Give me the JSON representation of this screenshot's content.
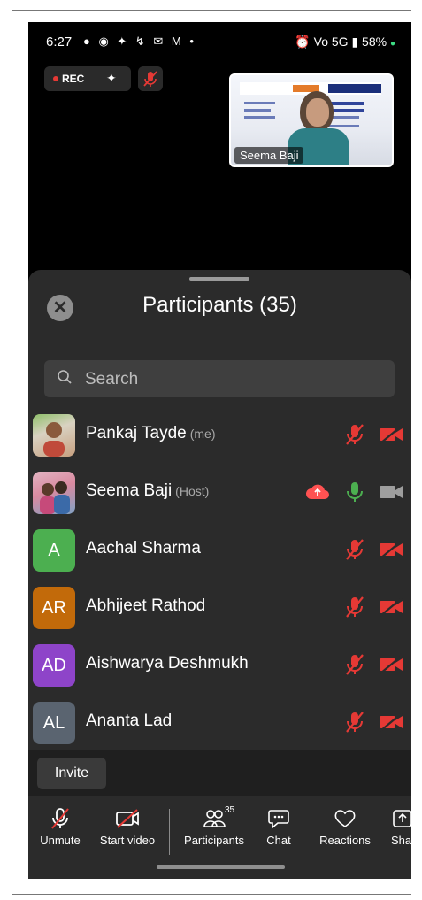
{
  "status_bar": {
    "time": "6:27",
    "left_icons": "● ◉ ✦ ↯ ✉ M •",
    "right_icons": "⏰ Vo 5G ▮ 58%",
    "battery": "58%"
  },
  "recording": {
    "label": "REC",
    "color": "#e53935"
  },
  "video_thumb": {
    "name": "Seema Baji"
  },
  "sheet": {
    "title": "Participants (35)",
    "search_placeholder": "Search"
  },
  "participants": [
    {
      "name": "Pankaj Tayde",
      "tag": "(me)",
      "avatar_type": "photo",
      "mic": "muted",
      "video": "off",
      "cloud": false
    },
    {
      "name": "Seema Baji",
      "tag": "(Host)",
      "avatar_type": "photo",
      "mic": "on",
      "video": "on",
      "cloud": true
    },
    {
      "name": "Aachal Sharma",
      "tag": "",
      "initials": "A",
      "color": "#4caf50",
      "mic": "muted",
      "video": "off",
      "cloud": false
    },
    {
      "name": "Abhijeet Rathod",
      "tag": "",
      "initials": "AR",
      "color": "#c26a0a",
      "mic": "muted",
      "video": "off",
      "cloud": false
    },
    {
      "name": "Aishwarya Deshmukh",
      "tag": "",
      "initials": "AD",
      "color": "#8e44c9",
      "mic": "muted",
      "video": "off",
      "cloud": false
    },
    {
      "name": "Ananta Lad",
      "tag": "",
      "initials": "AL",
      "color": "#5a6470",
      "mic": "muted",
      "video": "off",
      "cloud": false
    }
  ],
  "invite": {
    "label": "Invite"
  },
  "toolbar": {
    "unmute": "Unmute",
    "start_video": "Start video",
    "participants": "Participants",
    "participants_count": "35",
    "chat": "Chat",
    "reactions": "Reactions",
    "share": "Sha"
  },
  "colors": {
    "muted_red": "#e53935",
    "mic_green": "#4caf50",
    "cloud_red": "#ff5252",
    "video_grey": "#9e9e9e"
  }
}
